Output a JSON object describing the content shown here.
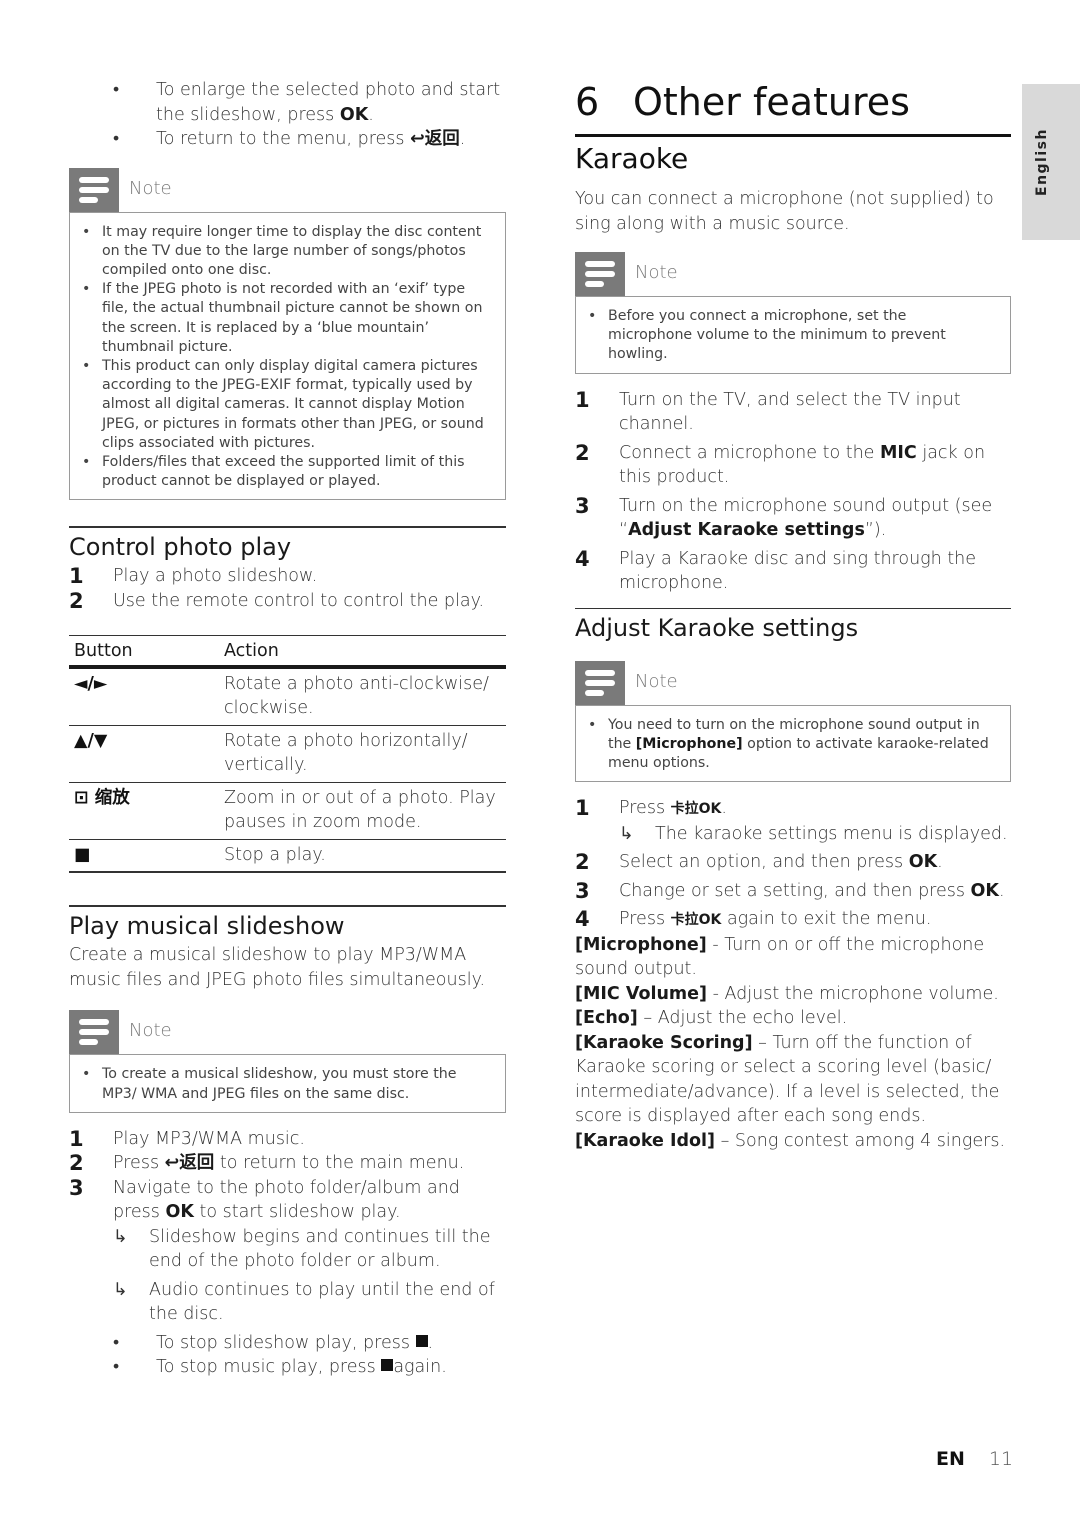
{
  "left": {
    "intro_bullets": [
      {
        "pre": "To enlarge the selected photo and start the slideshow, press ",
        "bold": "OK",
        "post": "."
      },
      {
        "pre": "To return to the menu, press ",
        "icon": "↩返回",
        "post": "."
      }
    ],
    "note1": {
      "label": "Note",
      "items": [
        "It may require longer time to display the disc content on the TV due to the large number of songs/photos compiled onto one disc.",
        "If the JPEG photo is not recorded with an ‘exif’ type file, the actual thumbnail picture cannot be shown on the screen. It is replaced by a ‘blue mountain’ thumbnail picture.",
        "This product can only display digital camera pictures according to the JPEG-EXIF format, typically used by almost all digital cameras. It cannot display Motion JPEG, or pictures in formats other than JPEG, or sound clips associated with pictures.",
        "Folders/files that exceed the supported limit of this product cannot be displayed or played."
      ]
    },
    "control_photo": {
      "heading": "Control photo play",
      "steps": [
        {
          "num": "1",
          "text": "Play a photo slideshow."
        },
        {
          "num": "2",
          "text": "Use the remote control to control the play."
        }
      ],
      "table": {
        "headers": [
          "Button",
          "Action"
        ],
        "rows": [
          {
            "button": "◄/►",
            "action": "Rotate a photo anti-clockwise/ clockwise."
          },
          {
            "button": "▲/▼",
            "action": "Rotate a photo horizontally/ vertically."
          },
          {
            "button": "⊡ 缩放",
            "action": "Zoom in or out of a photo. Play pauses in zoom mode."
          },
          {
            "button": "■",
            "action": "Stop a play."
          }
        ]
      }
    },
    "musical_slideshow": {
      "heading": "Play musical slideshow",
      "intro": "Create a musical slideshow to play MP3/WMA music files and JPEG photo files simultaneously.",
      "note": {
        "label": "Note",
        "items": [
          "To create a musical slideshow, you must store the MP3/ WMA and JPEG files on the same disc."
        ]
      },
      "steps": [
        {
          "num": "1",
          "text": "Play MP3/WMA music."
        },
        {
          "num": "2",
          "pre": "Press ",
          "icon": "↩返回",
          "post": " to return to the main menu."
        },
        {
          "num": "3",
          "pre": "Navigate to the photo folder/album and press ",
          "bold": "OK",
          "post": " to start slideshow play."
        }
      ],
      "results": [
        "Slideshow begins and continues till the end of the photo folder or album.",
        "Audio continues to play until the end of the disc."
      ],
      "tips": [
        {
          "pre": "To stop slideshow play, press ",
          "post": "."
        },
        {
          "pre": "To stop music play, press ",
          "post": "again."
        }
      ]
    }
  },
  "right": {
    "chapter_num": "6",
    "chapter_title": "Other features",
    "karaoke": {
      "heading": "Karaoke",
      "intro": "You can connect a microphone (not supplied) to sing along with a music source.",
      "note": {
        "label": "Note",
        "items": [
          "Before you connect a microphone, set the microphone volume to the minimum to prevent howling."
        ]
      },
      "steps": [
        {
          "num": "1",
          "text": "Turn on the TV, and select the TV input channel."
        },
        {
          "num": "2",
          "pre": "Connect a microphone to the ",
          "bold": "MIC",
          "post": " jack on this product."
        },
        {
          "num": "3",
          "pre": "Turn on the microphone sound output (see “",
          "bold": "Adjust Karaoke settings",
          "post": "”)."
        },
        {
          "num": "4",
          "text": "Play a Karaoke disc and sing through the microphone."
        }
      ]
    },
    "adjust": {
      "heading": "Adjust Karaoke settings",
      "note": {
        "label": "Note",
        "pre": "You need to turn on the microphone sound output in the ",
        "bold": "[Microphone]",
        "post": " option to activate karaoke-related menu options."
      },
      "steps": [
        {
          "num": "1",
          "pre": "Press ",
          "icon": "卡拉OK",
          "post": ".",
          "result": "The karaoke settings menu is displayed."
        },
        {
          "num": "2",
          "pre": "Select an option, and then press ",
          "bold": "OK",
          "post": "."
        },
        {
          "num": "3",
          "pre": "Change or set a setting, and then press ",
          "bold": "OK",
          "post": "."
        },
        {
          "num": "4",
          "pre": "Press ",
          "icon": "卡拉OK",
          "post": " again to exit the menu."
        }
      ],
      "options": [
        {
          "name": "[Microphone]",
          "desc": " - Turn on or off the microphone sound output."
        },
        {
          "name": "[MIC Volume]",
          "desc": " - Adjust the microphone volume."
        },
        {
          "name": "[Echo]",
          "desc": " – Adjust the echo level."
        },
        {
          "name": "[Karaoke Scoring]",
          "desc": " – Turn off the function of Karaoke scoring or select a scoring level (basic/ intermediate/advance). If a level is selected, the score is displayed after each song ends."
        },
        {
          "name": "[Karaoke Idol]",
          "desc": " – Song contest among 4 singers."
        }
      ]
    }
  },
  "side_tab": {
    "label": "English"
  },
  "footer": {
    "lang": "EN",
    "page": "11"
  },
  "glyphs": {
    "bullet": "•",
    "arrow": "↳"
  }
}
